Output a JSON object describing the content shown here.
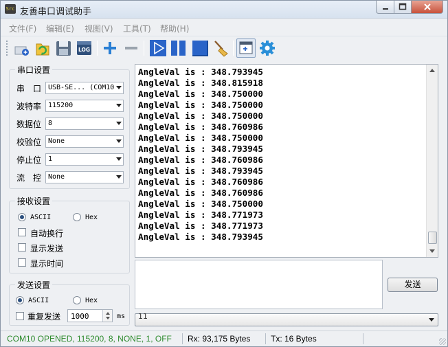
{
  "window": {
    "title": "友善串口调试助手",
    "icon_text": "Src"
  },
  "menu": [
    "文件(F)",
    "编辑(E)",
    "视图(V)",
    "工具(T)",
    "帮助(H)"
  ],
  "toolbar": {
    "log_label": "LOG"
  },
  "serial_settings": {
    "title": "串口设置",
    "port_label": "串　口",
    "port_value": "USB-SE... (COM10",
    "baud_label": "波特率",
    "baud_value": "115200",
    "databits_label": "数据位",
    "databits_value": "8",
    "parity_label": "校验位",
    "parity_value": "None",
    "stopbits_label": "停止位",
    "stopbits_value": "1",
    "flow_label": "流　控",
    "flow_value": "None"
  },
  "receive_settings": {
    "title": "接收设置",
    "ascii_label": "ASCII",
    "hex_label": "Hex",
    "auto_wrap_label": "自动换行",
    "show_send_label": "显示发送",
    "show_time_label": "显示时间"
  },
  "send_settings": {
    "title": "发送设置",
    "ascii_label": "ASCII",
    "hex_label": "Hex",
    "repeat_label": "重复发送",
    "repeat_interval": "1000",
    "unit": "ms"
  },
  "receive_lines": [
    "AngleVal is : 348.793945",
    "AngleVal is : 348.815918",
    "AngleVal is : 348.750000",
    "AngleVal is : 348.750000",
    "AngleVal is : 348.750000",
    "AngleVal is : 348.760986",
    "AngleVal is : 348.750000",
    "AngleVal is : 348.793945",
    "AngleVal is : 348.760986",
    "AngleVal is : 348.793945",
    "AngleVal is : 348.760986",
    "AngleVal is : 348.760986",
    "AngleVal is : 348.750000",
    "AngleVal is : 348.771973",
    "AngleVal is : 348.771973",
    "AngleVal is : 348.793945"
  ],
  "send_button_label": "发送",
  "send_history_value": "11",
  "status": {
    "connection": "COM10 OPENED, 115200, 8, NONE, 1, OFF",
    "rx": "Rx: 93,175 Bytes",
    "tx": "Tx: 16 Bytes"
  },
  "colors": {
    "status_ok": "#2e8b2e",
    "accent_blue": "#2a64c8"
  }
}
